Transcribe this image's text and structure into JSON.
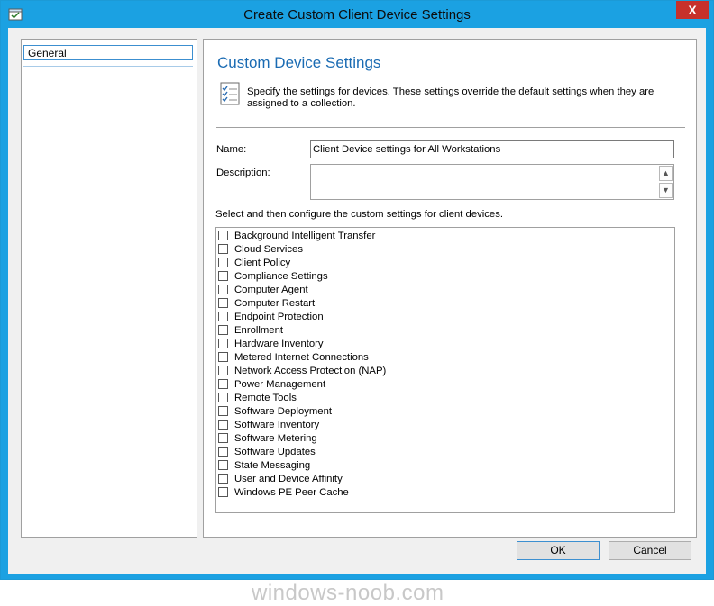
{
  "window": {
    "title": "Create Custom Client Device Settings",
    "close_label": "X"
  },
  "nav": {
    "items": [
      {
        "label": "General"
      }
    ]
  },
  "content": {
    "heading": "Custom Device Settings",
    "intro": "Specify the settings for devices. These settings override the default settings when they are assigned to a collection.",
    "name_label": "Name:",
    "name_value": "Client Device settings for All Workstations",
    "description_label": "Description:",
    "description_value": "",
    "select_label": "Select and then configure the custom settings for client devices.",
    "settings": [
      "Background Intelligent Transfer",
      "Cloud Services",
      "Client Policy",
      "Compliance Settings",
      "Computer Agent",
      "Computer Restart",
      "Endpoint Protection",
      "Enrollment",
      "Hardware Inventory",
      "Metered Internet Connections",
      "Network Access Protection (NAP)",
      "Power Management",
      "Remote Tools",
      "Software Deployment",
      "Software Inventory",
      "Software Metering",
      "Software Updates",
      "State Messaging",
      "User and Device Affinity",
      "Windows PE Peer Cache"
    ]
  },
  "buttons": {
    "ok": "OK",
    "cancel": "Cancel"
  },
  "watermark": "windows-noob.com",
  "colors": {
    "titlebar": "#1ba1e2",
    "close": "#c7312b",
    "heading": "#1a6bb3"
  },
  "icons": {
    "app": "window-check-icon",
    "intro": "settings-checklist-icon"
  }
}
